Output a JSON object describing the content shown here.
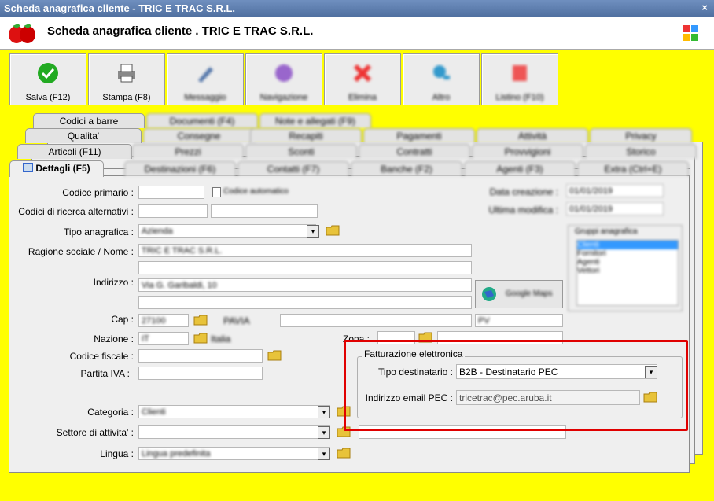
{
  "window": {
    "title": "Scheda anagrafica cliente - TRIC E TRAC S.R.L.",
    "close_glyph": "×"
  },
  "header": {
    "name": "Scheda anagrafica cliente . TRIC E TRAC S.R.L."
  },
  "toolbar": {
    "save_label": "Salva (F12)",
    "print_label": "Stampa (F8)",
    "b3": "Messaggio",
    "b4": "Navigazione",
    "b5": "Elimina",
    "b6": "Altro",
    "b7": "Listino (F10)"
  },
  "tabs": {
    "row1": [
      "Codici a barre",
      "Documenti (F4)",
      "Note e allegati (F9)"
    ],
    "row2": [
      "Qualita'",
      "Consegne",
      "Recapiti",
      "Pagamenti",
      "Attività",
      "Privacy"
    ],
    "row3": [
      "Articoli (F11)",
      "Prezzi",
      "Sconti",
      "Contratti",
      "Provvigioni",
      "Storico"
    ],
    "row4": [
      "Dettagli (F5)",
      "Destinazioni (F6)",
      "Contatti (F7)",
      "Banche (F2)",
      "Agenti (F3)",
      "Extra (Ctrl+E)"
    ]
  },
  "form": {
    "codice_primario": "Codice primario :",
    "codici_alternativi": "Codici di ricerca alternativi :",
    "tipo_anagrafica": "Tipo anagrafica :",
    "tipo_anagrafica_val": "Azienda",
    "ragione_sociale": "Ragione sociale / Nome :",
    "ragione_sociale_val": "TRIC E TRAC S.R.L.",
    "indirizzo": "Indirizzo :",
    "indirizzo_val": "Via G. Garibaldi, 10",
    "cap": "Cap :",
    "cap_val": "27100",
    "citta_val": "PAVIA",
    "prov_val": "PV",
    "nazione": "Nazione :",
    "nazione_val": "IT",
    "nazione_nome": "Italia",
    "codice_fiscale": "Codice fiscale :",
    "partita_iva": "Partita IVA :",
    "categoria": "Categoria :",
    "categoria_val": "Clienti",
    "settore": "Settore di attivita' :",
    "lingua": "Lingua :",
    "lingua_val": "Lingua predefinita",
    "zona": "Zona :",
    "automatic_code": "Codice automatico",
    "data_creazione": "Data creazione :",
    "ultima_modifica": "Ultima modifica :",
    "date_val": "01/01/2019",
    "gruppi_title": "Gruppi anagrafica",
    "gruppi": [
      "Clienti",
      "Fornitori",
      "Agenti",
      "Vettori"
    ],
    "google_maps": "Google Maps"
  },
  "fe": {
    "title": "Fatturazione elettronica",
    "tipo_label": "Tipo destinatario :",
    "tipo_value": "B2B - Destinatario PEC",
    "pec_label": "Indirizzo email PEC :",
    "pec_value": "tricetrac@pec.aruba.it"
  },
  "colors": {
    "background": "#ffff00",
    "highlight": "#e00000"
  }
}
